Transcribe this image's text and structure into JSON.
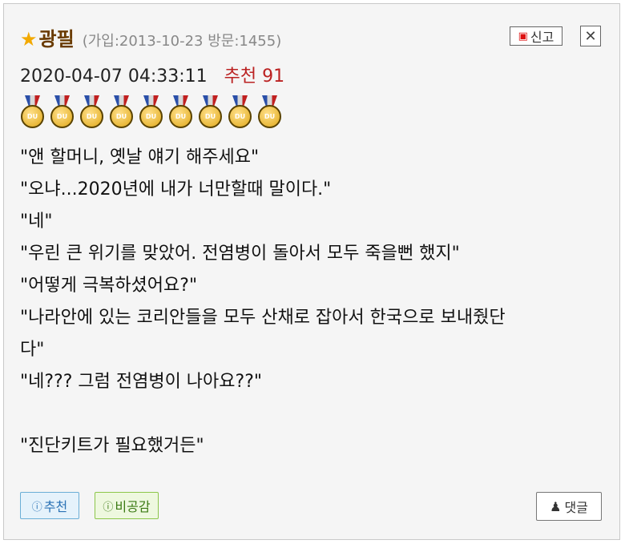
{
  "author": {
    "star": "★",
    "nickname": "광필",
    "meta": "(가입:2013-10-23 방문:1455)"
  },
  "actions": {
    "report_label": "신고",
    "close_symbol": "✕"
  },
  "post": {
    "datetime": "2020-04-07 04:33:11",
    "recommend_text": "추천 91"
  },
  "medals": {
    "count": 9,
    "label": "DU"
  },
  "body_lines": [
    "\"앤 할머니, 옛날 얘기 해주세요\"",
    "\"오냐...2020년에 내가 너만할때 말이다.\"",
    "\"네\"",
    "\"우린 큰 위기를 맞았어. 전염병이 돌아서 모두 죽을뻔 했지\"",
    "\"어떻게 극복하셨어요?\"",
    "\"나라안에 있는 코리안들을 모두 산채로 잡아서 한국으로 보내줬단",
    "다\"",
    "\"네??? 그럼 전염병이 나아요??\"",
    "",
    "\"진단키트가 필요했거든\""
  ],
  "footer": {
    "recommend_label": "추천",
    "disagree_label": "비공감",
    "comment_label": "댓글"
  }
}
